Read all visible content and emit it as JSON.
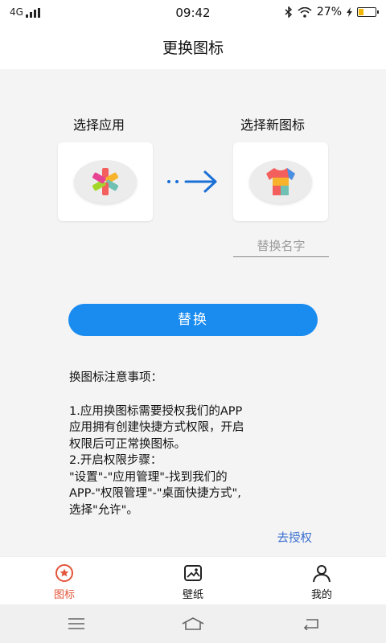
{
  "status_bar": {
    "network": "4G",
    "time": "09:42",
    "battery_percent": "27%",
    "battery_level": 0.27,
    "icons": [
      "bluetooth-icon",
      "wifi-icon",
      "charging-icon"
    ]
  },
  "header": {
    "title": "更换图标"
  },
  "main": {
    "select_app_label": "选择应用",
    "select_new_icon_label": "选择新图标",
    "name_placeholder": "替换名字",
    "name_value": "",
    "replace_button": "替换",
    "notes": {
      "title": "换图标注意事项：",
      "lines": [
        "1.应用换图标需要授权我们的APP",
        "应用拥有创建快捷方式权限，开启",
        "权限后可正常换图标。",
        "2.开启权限步骤：",
        "\"设置\"-\"应用管理\"-找到我们的",
        "APP-\"权限管理\"-\"桌面快捷方式\",",
        "选择\"允许\"。"
      ]
    },
    "authorize_link": "去授权"
  },
  "tab_bar": {
    "tabs": [
      {
        "label": "图标",
        "icon": "star-badge-icon",
        "active": true
      },
      {
        "label": "壁纸",
        "icon": "image-icon",
        "active": false
      },
      {
        "label": "我的",
        "icon": "person-icon",
        "active": false
      }
    ]
  },
  "nav_bar": {
    "buttons": [
      "menu-icon",
      "home-icon",
      "back-icon"
    ]
  },
  "colors": {
    "accent": "#1a8cf0",
    "active_tab": "#e2553a",
    "link": "#3a6fd0",
    "background": "#f4f4f4"
  }
}
